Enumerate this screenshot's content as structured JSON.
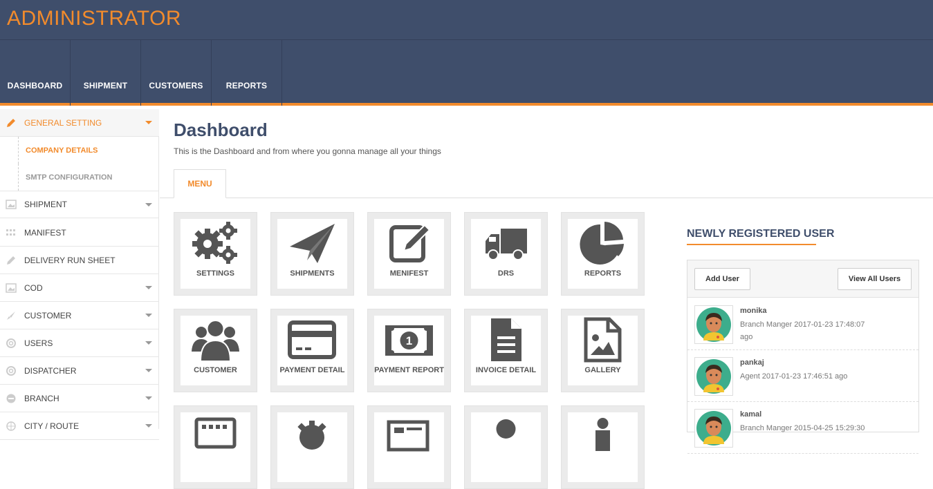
{
  "app": {
    "title": "ADMINISTRATOR"
  },
  "nav": {
    "items": [
      {
        "label": "DASHBOARD"
      },
      {
        "label": "SHIPMENT"
      },
      {
        "label": "CUSTOMERS"
      },
      {
        "label": "REPORTS"
      }
    ]
  },
  "sidebar": {
    "general": {
      "label": "GENERAL SETTING",
      "icon": "pencil-icon"
    },
    "sub": [
      {
        "label": "COMPANY DETAILS"
      },
      {
        "label": "SMTP CONFIGURATION"
      }
    ],
    "items": [
      {
        "label": "SHIPMENT",
        "icon": "image-icon"
      },
      {
        "label": "MANIFEST",
        "icon": "grid-icon"
      },
      {
        "label": "DELIVERY RUN SHEET",
        "icon": "pencil-icon"
      },
      {
        "label": "COD",
        "icon": "image-icon"
      },
      {
        "label": "CUSTOMER",
        "icon": "brush-icon"
      },
      {
        "label": "USERS",
        "icon": "lifebuoy-icon"
      },
      {
        "label": "DISPATCHER",
        "icon": "lifebuoy-icon"
      },
      {
        "label": "BRANCH",
        "icon": "minus-circle-icon"
      },
      {
        "label": "CITY / ROUTE",
        "icon": "globe-icon"
      }
    ]
  },
  "main": {
    "title": "Dashboard",
    "subtitle": "This is the Dashboard and from where you gonna manage all your things",
    "tab": "MENU",
    "tiles": [
      {
        "label": "SETTINGS",
        "icon": "gears-icon"
      },
      {
        "label": "SHIPMENTS",
        "icon": "paper-plane-icon"
      },
      {
        "label": "MENIFEST",
        "icon": "edit-icon"
      },
      {
        "label": "DRS",
        "icon": "truck-icon"
      },
      {
        "label": "REPORTS",
        "icon": "pie-chart-icon"
      },
      {
        "label": "CUSTOMER",
        "icon": "users-icon"
      },
      {
        "label": "PAYMENT DETAIL",
        "icon": "credit-card-icon"
      },
      {
        "label": "PAYMENT REPORT",
        "icon": "banknote-icon"
      },
      {
        "label": "INVOICE DETAIL",
        "icon": "document-icon"
      },
      {
        "label": "GALLERY",
        "icon": "image-file-icon"
      }
    ]
  },
  "users_panel": {
    "title": "NEWLY REGISTERED USER",
    "add_label": "Add User",
    "view_label": "View All Users",
    "users": [
      {
        "name": "monika",
        "meta": "Branch Manger 2017-01-23 17:48:07 ago"
      },
      {
        "name": "pankaj",
        "meta": "Agent 2017-01-23 17:46:51 ago"
      },
      {
        "name": "kamal",
        "meta": "Branch Manger 2015-04-25 15:29:30"
      }
    ]
  },
  "colors": {
    "accent": "#f28b2c",
    "nav_bg": "#3f4e6b",
    "icon": "#555555"
  }
}
